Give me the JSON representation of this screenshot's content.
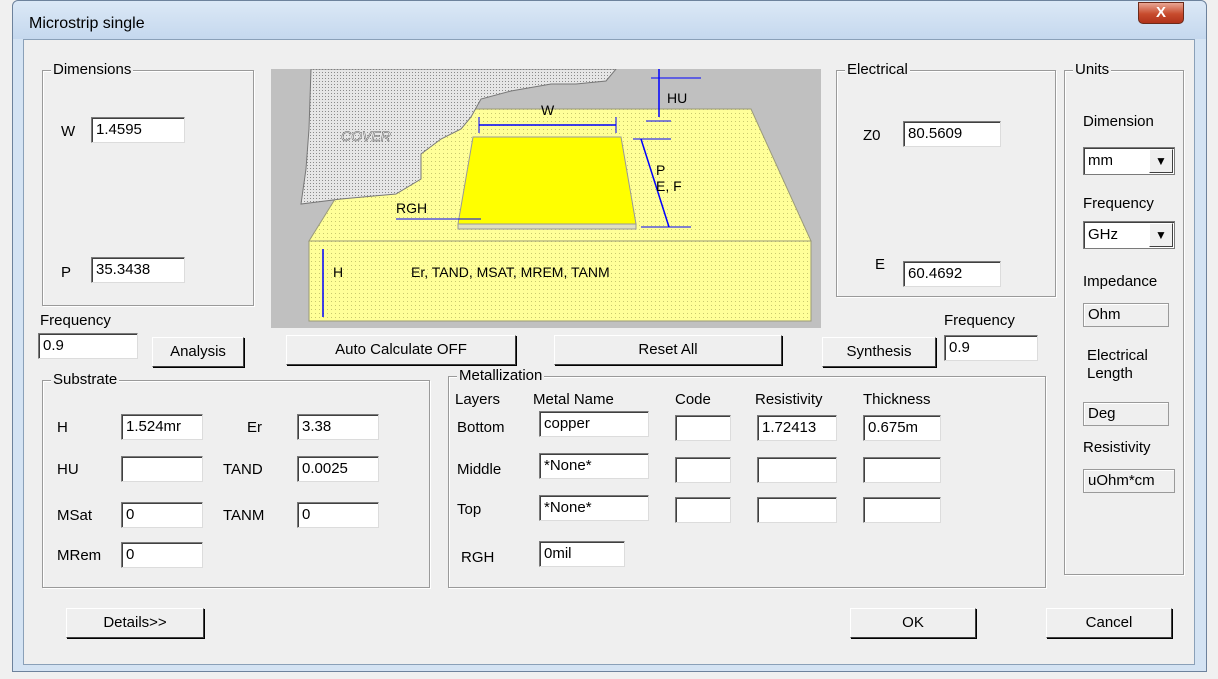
{
  "window": {
    "title": "Microstrip single",
    "close_label": "X"
  },
  "dimensions": {
    "title": "Dimensions",
    "w_label": "W",
    "w_value": "1.4595",
    "p_label": "P",
    "p_value": "35.3438"
  },
  "diagram": {
    "cover": "COVER",
    "w": "W",
    "hu": "HU",
    "p_ef": [
      "P",
      "E, F"
    ],
    "rgh": "RGH",
    "h": "H",
    "sub_props": "Er, TAND, MSAT, MREM, TANM"
  },
  "electrical": {
    "title": "Electrical",
    "z0_label": "Z0",
    "z0_value": "80.5609",
    "e_label": "E",
    "e_value": "60.4692"
  },
  "units": {
    "title": "Units",
    "dimension_label": "Dimension",
    "dimension_value": "mm",
    "frequency_label": "Frequency",
    "frequency_value": "GHz",
    "impedance_label": "Impedance",
    "impedance_value": "Ohm",
    "elec_length_label": "Electrical Length",
    "elec_length_value": "Deg",
    "resistivity_label": "Resistivity",
    "resistivity_value": "uOhm*cm"
  },
  "analysis": {
    "frequency_label": "Frequency",
    "frequency_value": "0.9",
    "analysis_button": "Analysis"
  },
  "toolbar": {
    "auto_calc_button": "Auto Calculate OFF",
    "reset_button": "Reset  All"
  },
  "synthesis": {
    "frequency_label": "Frequency",
    "frequency_value": "0.9",
    "synthesis_button": "Synthesis"
  },
  "substrate": {
    "title": "Substrate",
    "h_label": "H",
    "h_value": "1.524mr",
    "er_label": "Er",
    "er_value": "3.38",
    "hu_label": "HU",
    "hu_value": "",
    "tand_label": "TAND",
    "tand_value": "0.0025",
    "msat_label": "MSat",
    "msat_value": "0",
    "tanm_label": "TANM",
    "tanm_value": "0",
    "mrem_label": "MRem",
    "mrem_value": "0"
  },
  "metallization": {
    "title": "Metallization",
    "headers": {
      "layers": "Layers",
      "metal_name": "Metal Name",
      "code": "Code",
      "resistivity": "Resistivity",
      "thickness": "Thickness"
    },
    "rows": [
      {
        "layer": "Bottom",
        "metal": "copper",
        "code": "",
        "resistivity": "1.72413",
        "thickness": "0.675m"
      },
      {
        "layer": "Middle",
        "metal": "*None*",
        "code": "",
        "resistivity": "",
        "thickness": ""
      },
      {
        "layer": "Top",
        "metal": "*None*",
        "code": "",
        "resistivity": "",
        "thickness": ""
      }
    ],
    "rgh_label": "RGH",
    "rgh_value": "0mil"
  },
  "footer": {
    "details_button": "Details>>",
    "ok_button": "OK",
    "cancel_button": "Cancel"
  },
  "colors": {
    "window_frame": "#d4e3f3",
    "dialog_bg": "#efefef",
    "strip": "#ffff00",
    "substrate": "#ffff99",
    "cover": "#d9d9d9",
    "dimension_lines": "#0000ff"
  }
}
